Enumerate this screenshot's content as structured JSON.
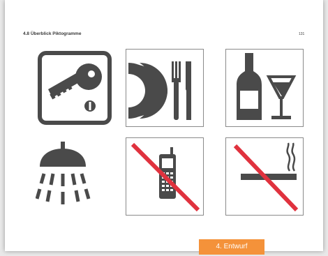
{
  "header": {
    "section_title": "4.8 Überblick Piktogramme",
    "page_number": "131"
  },
  "pictograms": [
    {
      "icon": "room-key-icon"
    },
    {
      "icon": "plate-cutlery-icon"
    },
    {
      "icon": "bottle-glass-icon"
    },
    {
      "icon": "shower-icon"
    },
    {
      "icon": "no-mobile-phone-icon"
    },
    {
      "icon": "no-smoking-icon"
    }
  ],
  "colors": {
    "pictogram": "#4a4a4a",
    "prohibition": "#e0323e",
    "badge": "#f4923a"
  },
  "footer": {
    "badge_label": "4. Entwurf"
  }
}
